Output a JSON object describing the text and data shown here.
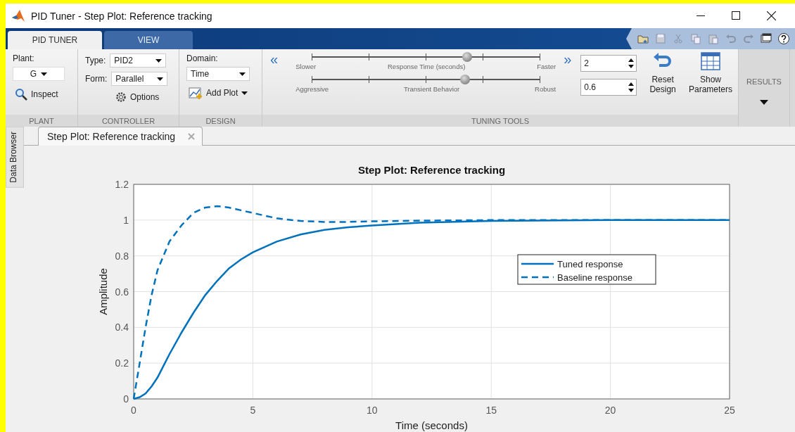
{
  "window": {
    "title": "PID Tuner - Step Plot: Reference tracking"
  },
  "ribbon_tabs": [
    {
      "label": "PID TUNER",
      "selected": true
    },
    {
      "label": "VIEW",
      "selected": false
    }
  ],
  "plant": {
    "label": "Plant:",
    "value": "G",
    "inspect": "Inspect",
    "section": "PLANT"
  },
  "controller": {
    "type_label": "Type:",
    "type": "PID2",
    "form_label": "Form:",
    "form": "Parallel",
    "options": "Options",
    "section": "CONTROLLER"
  },
  "design": {
    "domain_label": "Domain:",
    "domain": "Time",
    "add_plot": "Add Plot",
    "section": "DESIGN"
  },
  "tuning_tools": {
    "section": "TUNING TOOLS",
    "slower_button": "«",
    "faster_button": "»",
    "sliders": [
      {
        "left_label": "Slower",
        "title": "Response Time (seconds)",
        "right_label": "Faster",
        "level": 0.68,
        "value": "2"
      },
      {
        "left_label": "Aggressive",
        "title": "Transient Behavior",
        "right_label": "Robust",
        "level": 0.67,
        "value": "0.6"
      }
    ],
    "reset": "Reset Design",
    "show": "Show Parameters"
  },
  "results": {
    "section": "RESULTS"
  },
  "side_tab": "Data Browser",
  "document_tabs": [
    {
      "label": "Step Plot: Reference tracking",
      "selected": true
    }
  ],
  "chart_data": {
    "type": "line",
    "title": "Step Plot: Reference tracking",
    "xlabel": "Time (seconds)",
    "ylabel": "Amplitude",
    "x": [
      0,
      0.25,
      0.5,
      0.75,
      1,
      1.5,
      2,
      2.5,
      3,
      3.5,
      4,
      4.5,
      5,
      6,
      7,
      8,
      9,
      10,
      12,
      15,
      20,
      25
    ],
    "series": [
      {
        "name": "Tuned response",
        "color": "#0072bd",
        "line_style": "solid",
        "values": [
          0,
          0.01,
          0.03,
          0.07,
          0.12,
          0.25,
          0.37,
          0.48,
          0.58,
          0.66,
          0.73,
          0.78,
          0.82,
          0.88,
          0.92,
          0.945,
          0.96,
          0.97,
          0.985,
          0.995,
          1,
          1
        ]
      },
      {
        "name": "Baseline response",
        "color": "#0072bd",
        "line_style": "dashed",
        "values": [
          0,
          0.2,
          0.4,
          0.58,
          0.72,
          0.88,
          0.97,
          1.04,
          1.07,
          1.078,
          1.07,
          1.055,
          1.04,
          1.01,
          0.995,
          0.99,
          0.99,
          0.993,
          0.997,
          1,
          1,
          1
        ]
      }
    ],
    "xlim": [
      0,
      25
    ],
    "ylim": [
      0,
      1.2
    ],
    "xticks": [
      0,
      5,
      10,
      15,
      20,
      25
    ],
    "yticks": [
      0,
      0.2,
      0.4,
      0.6,
      0.8,
      1,
      1.2
    ],
    "grid": true,
    "legend": true
  }
}
